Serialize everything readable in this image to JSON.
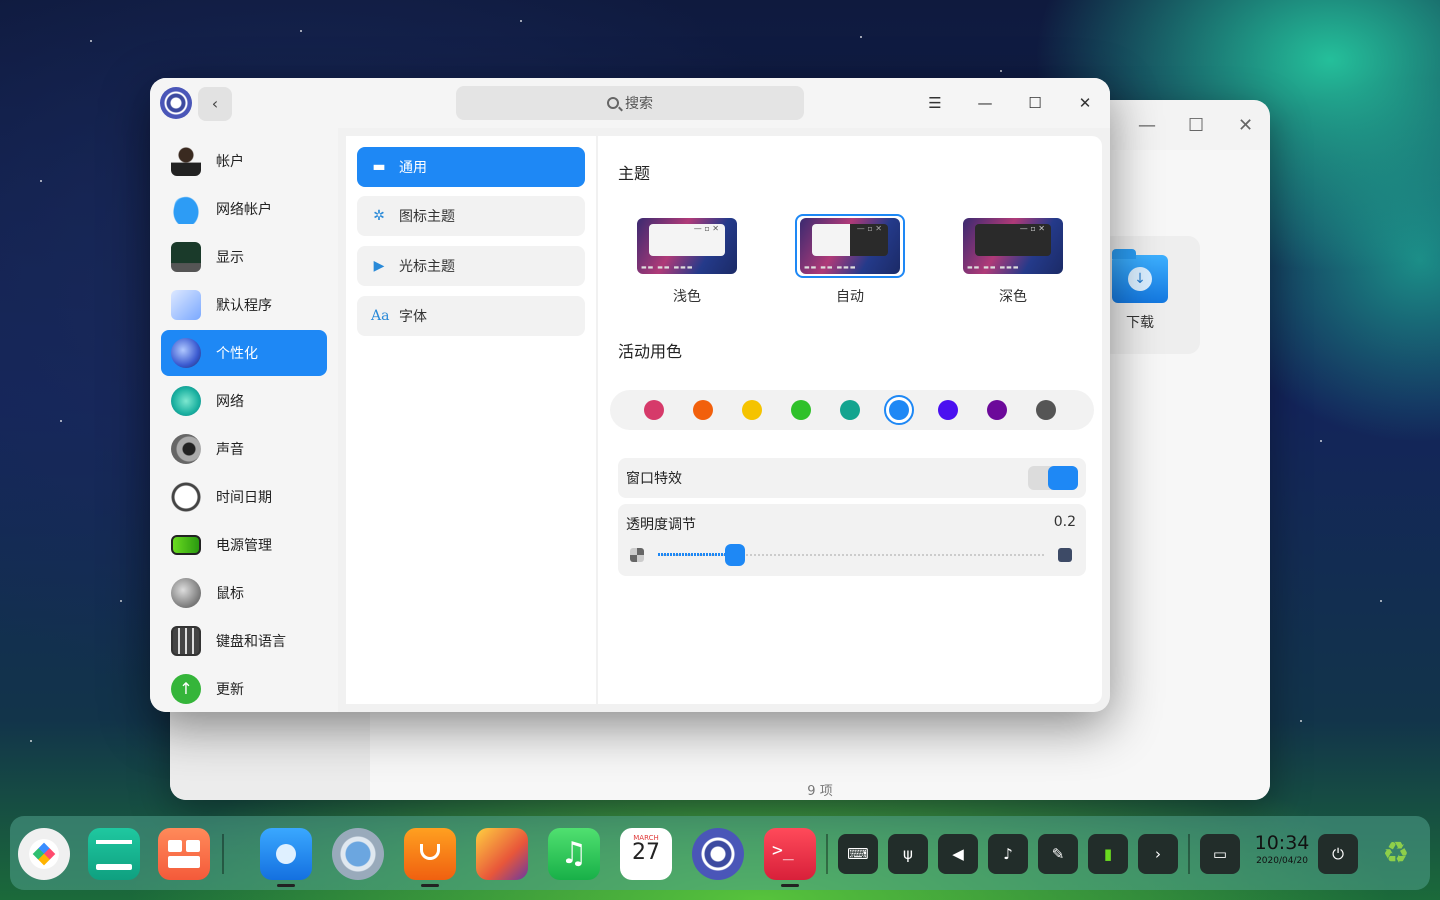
{
  "background_window": {
    "folder_label": "下载",
    "items_count": "9 项"
  },
  "window": {
    "search_placeholder": "搜索",
    "back_icon": "‹",
    "menu_icon": "☰",
    "minimize_icon": "—",
    "maximize_icon": "☐",
    "close_icon": "✕"
  },
  "sidebar": {
    "items": [
      {
        "label": "帐户",
        "icon": "account-icon"
      },
      {
        "label": "网络帐户",
        "icon": "cloud-icon"
      },
      {
        "label": "显示",
        "icon": "display-icon"
      },
      {
        "label": "默认程序",
        "icon": "default-apps-icon"
      },
      {
        "label": "个性化",
        "icon": "personalization-icon",
        "active": true
      },
      {
        "label": "网络",
        "icon": "network-icon"
      },
      {
        "label": "声音",
        "icon": "sound-icon"
      },
      {
        "label": "时间日期",
        "icon": "clock-icon"
      },
      {
        "label": "电源管理",
        "icon": "battery-icon"
      },
      {
        "label": "鼠标",
        "icon": "mouse-icon"
      },
      {
        "label": "键盘和语言",
        "icon": "keyboard-icon"
      },
      {
        "label": "更新",
        "icon": "update-icon"
      }
    ]
  },
  "submenu": {
    "items": [
      {
        "label": "通用",
        "icon": "▬",
        "active": true
      },
      {
        "label": "图标主题",
        "icon": "✲"
      },
      {
        "label": "光标主题",
        "icon": "▶"
      },
      {
        "label": "字体",
        "icon": "Aa"
      }
    ]
  },
  "content": {
    "theme_title": "主题",
    "themes": [
      {
        "label": "浅色"
      },
      {
        "label": "自动",
        "selected": true
      },
      {
        "label": "深色"
      }
    ],
    "accent_title": "活动用色",
    "accent_colors": [
      "#d63a6a",
      "#f2600c",
      "#f5c300",
      "#2fc12a",
      "#13a48f",
      "#1e88f5",
      "#4a10f0",
      "#6c0a9a",
      "#555555"
    ],
    "accent_selected_index": 5,
    "window_effect_label": "窗口特效",
    "window_effect_on": true,
    "opacity_label": "透明度调节",
    "opacity_value": "0.2",
    "opacity_fraction": 0.2
  },
  "dock": {
    "clock_time": "10:34",
    "clock_date": "2020/04/20",
    "tray_icons": [
      "keyboard-tray-icon",
      "usb-icon",
      "volume-icon",
      "notification-icon",
      "pen-icon",
      "battery-tray-icon",
      "expand-icon"
    ]
  },
  "colors": {
    "accent": "#1e88f5"
  }
}
